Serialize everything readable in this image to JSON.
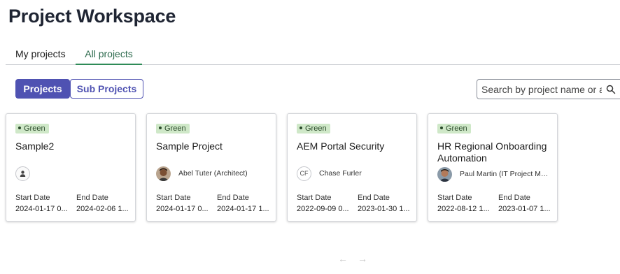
{
  "page": {
    "title": "Project Workspace"
  },
  "tabs": [
    {
      "label": "My projects",
      "selected": false
    },
    {
      "label": "All projects",
      "selected": true
    }
  ],
  "view_toggle": {
    "projects_label": "Projects",
    "sub_projects_label": "Sub Projects",
    "selected": "Projects"
  },
  "search": {
    "placeholder": "Search by project name or a",
    "value": ""
  },
  "labels": {
    "start_date": "Start Date",
    "end_date": "End Date"
  },
  "colors": {
    "accent": "#4f52b2",
    "tab_active": "#2e6b4e",
    "status_green_bg": "#cfe8c8"
  },
  "cards": [
    {
      "status": "Green",
      "title": "Sample2",
      "owner": "",
      "owner_avatar": "user-placeholder-icon",
      "start_date": "2024-01-17 0...",
      "end_date": "2024-02-06 1..."
    },
    {
      "status": "Green",
      "title": "Sample Project",
      "owner": "Abel Tuter (Architect)",
      "owner_avatar": "avatar-photo",
      "start_date": "2024-01-17 0...",
      "end_date": "2024-01-17 1..."
    },
    {
      "status": "Green",
      "title": "AEM Portal Security",
      "owner": "Chase Furler",
      "owner_initials": "CF",
      "start_date": "2022-09-09 0...",
      "end_date": "2023-01-30 1..."
    },
    {
      "status": "Green",
      "title": "HR Regional Onboarding Automation",
      "owner": "Paul Martin (IT Project Ma...",
      "owner_avatar": "avatar-photo",
      "start_date": "2022-08-12 1...",
      "end_date": "2023-01-07 1..."
    }
  ],
  "pagination": {
    "prev_icon": "arrow-left-icon",
    "next_icon": "arrow-right-icon"
  }
}
